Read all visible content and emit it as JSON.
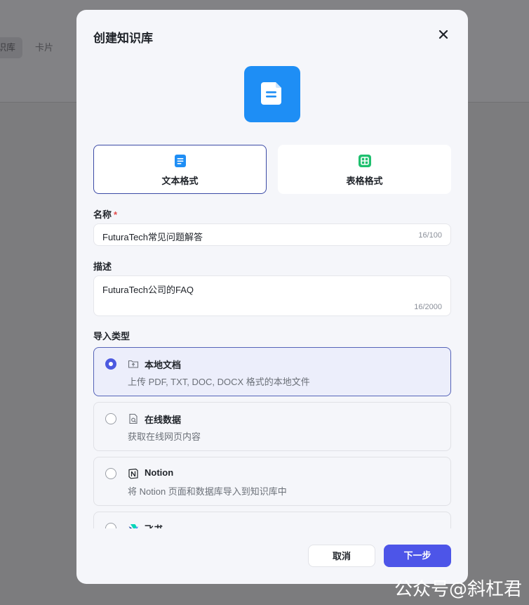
{
  "background": {
    "tabs": [
      {
        "label": "识库",
        "active": true
      },
      {
        "label": "卡片",
        "active": false
      }
    ]
  },
  "watermark": "公众号@斜杠君",
  "modal": {
    "title": "创建知识库",
    "formats": [
      {
        "label": "文本格式",
        "selected": true,
        "icon": "document-icon"
      },
      {
        "label": "表格格式",
        "selected": false,
        "icon": "table-icon"
      }
    ],
    "name": {
      "label": "名称",
      "required_mark": "*",
      "value": "FuturaTech常见问题解答",
      "counter": "16/100"
    },
    "description": {
      "label": "描述",
      "value": "FuturaTech公司的FAQ",
      "counter": "16/2000"
    },
    "import": {
      "label": "导入类型",
      "options": [
        {
          "title": "本地文档",
          "desc": "上传 PDF, TXT, DOC, DOCX 格式的本地文件",
          "selected": true,
          "icon": "upload-folder-icon"
        },
        {
          "title": "在线数据",
          "desc": "获取在线网页内容",
          "selected": false,
          "icon": "web-page-icon"
        },
        {
          "title": "Notion",
          "desc": "将 Notion 页面和数据库导入到知识库中",
          "selected": false,
          "icon": "notion-icon"
        },
        {
          "title": "飞书",
          "desc": "",
          "selected": false,
          "icon": "feishu-icon"
        }
      ]
    },
    "buttons": {
      "cancel": "取消",
      "next": "下一步"
    }
  },
  "colors": {
    "accent": "#4d55e8",
    "hero_blue": "#1e8ef5",
    "table_green": "#1fc06f",
    "required": "#e34c4c"
  }
}
